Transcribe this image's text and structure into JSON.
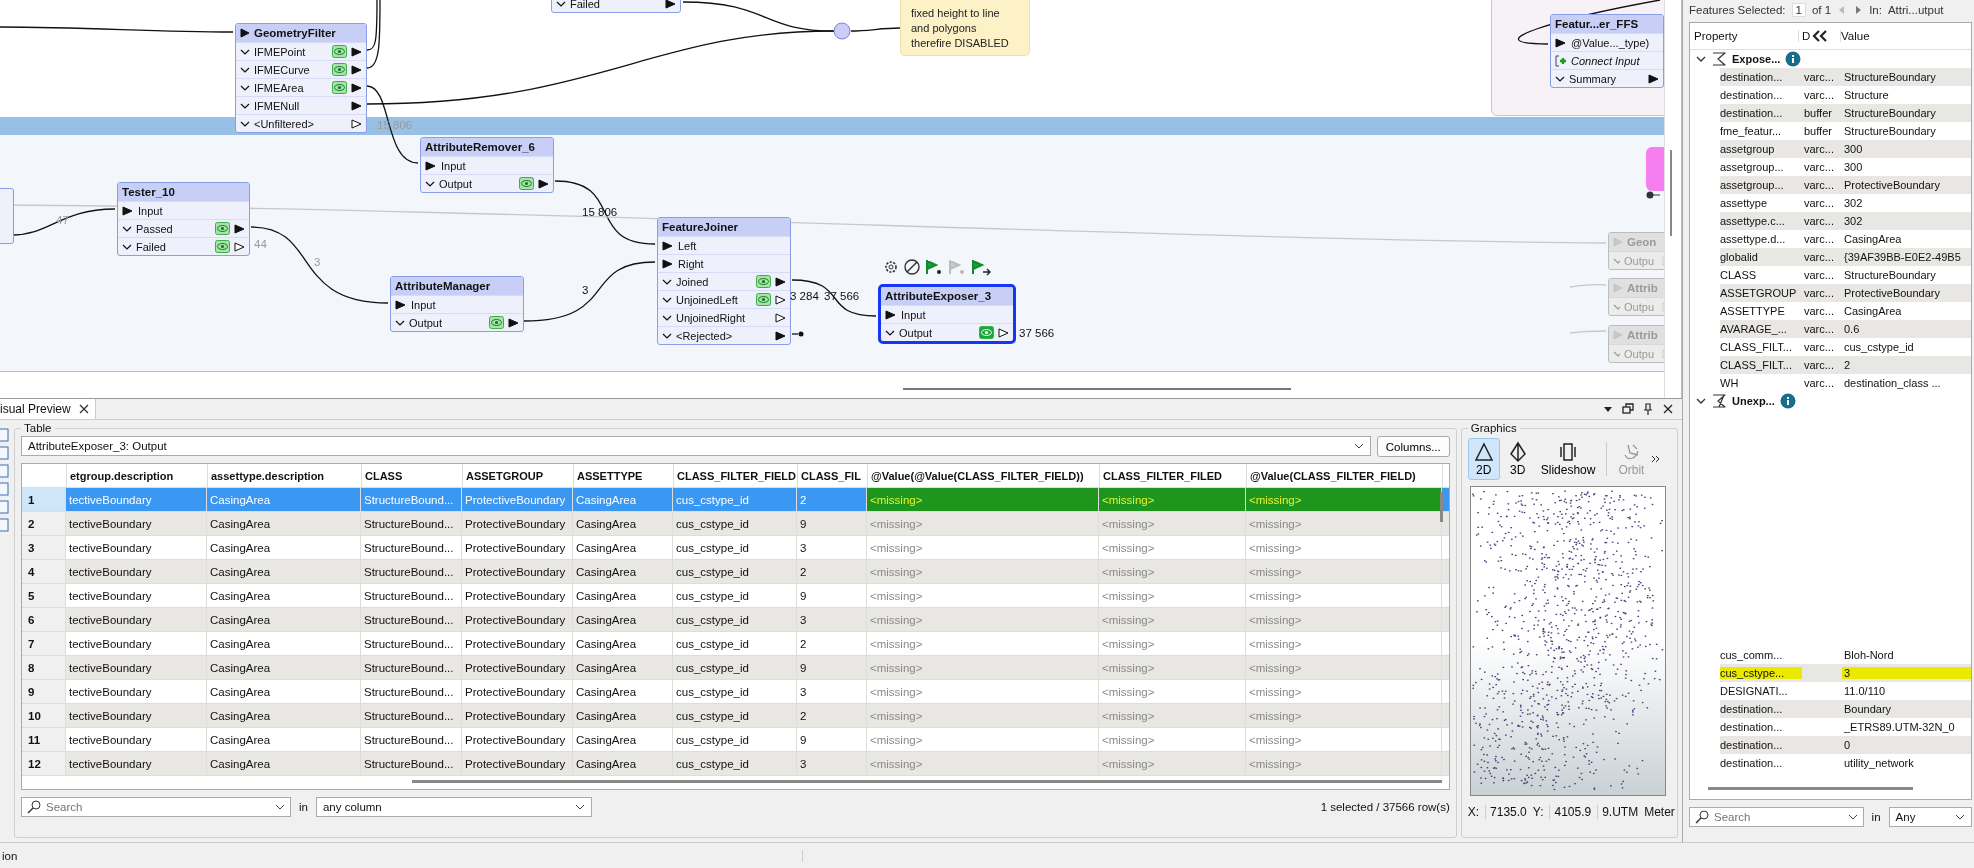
{
  "canvas": {
    "nodes": [
      {
        "selected": false,
        "disabled": false,
        "ports": [
          {
            "label": "Failed",
            "kind": "output",
            "cached": false,
            "connected": true
          }
        ]
      },
      {
        "title": "GeometryFilter",
        "selected": false,
        "disabled": false,
        "header_input": true,
        "ports": [
          {
            "label": "IFMEPoint",
            "kind": "output",
            "cached": true,
            "connected": true
          },
          {
            "label": "IFMECurve",
            "kind": "output",
            "cached": true,
            "connected": true
          },
          {
            "label": "IFMEArea",
            "kind": "output",
            "cached": true,
            "connected": true
          },
          {
            "label": "IFMENull",
            "kind": "output",
            "cached": false,
            "connected": true
          },
          {
            "label": "<Unfiltered>",
            "kind": "output",
            "cached": false,
            "connected": false
          }
        ]
      },
      {
        "title": "AttributeRemover_6",
        "selected": false,
        "disabled": false,
        "header_input": false,
        "ports": [
          {
            "label": "Input",
            "kind": "input",
            "connected": true
          },
          {
            "label": "Output",
            "kind": "output",
            "cached": true,
            "connected": true
          }
        ]
      },
      {
        "title": "Tester_10",
        "selected": false,
        "disabled": false,
        "header_input": false,
        "ports": [
          {
            "label": "Input",
            "kind": "input",
            "connected": true
          },
          {
            "label": "Passed",
            "kind": "output",
            "cached": true,
            "connected": true
          },
          {
            "label": "Failed",
            "kind": "output",
            "cached": true,
            "connected": false
          }
        ]
      },
      {
        "title": "FeatureJoiner",
        "selected": false,
        "disabled": false,
        "header_input": false,
        "ports": [
          {
            "label": "Left",
            "kind": "input",
            "connected": true
          },
          {
            "label": "Right",
            "kind": "input",
            "connected": true
          },
          {
            "label": "Joined",
            "kind": "output",
            "cached": true,
            "connected": true
          },
          {
            "label": "UnjoinedLeft",
            "kind": "output",
            "cached": true,
            "connected": false
          },
          {
            "label": "UnjoinedRight",
            "kind": "output",
            "cached": false,
            "connected": false
          },
          {
            "label": "<Rejected>",
            "kind": "output",
            "cached": false,
            "connected": true
          }
        ]
      },
      {
        "title": "AttributeManager",
        "selected": false,
        "disabled": false,
        "header_input": false,
        "ports": [
          {
            "label": "Input",
            "kind": "input",
            "connected": true
          },
          {
            "label": "Output",
            "kind": "output",
            "cached": true,
            "connected": true
          }
        ]
      },
      {
        "title": "AttributeExposer_3",
        "selected": true,
        "disabled": false,
        "header_input": false,
        "ports": [
          {
            "label": "Input",
            "kind": "input",
            "connected": true
          },
          {
            "label": "Output",
            "kind": "output",
            "cached": true,
            "connected": false
          }
        ]
      },
      {
        "title": "Featur...er_FFS",
        "selected": false,
        "disabled": false,
        "header_input": false,
        "ports": [
          {
            "label": "@Value..._type)",
            "kind": "input",
            "connected": true
          },
          {
            "label": "Connect Input",
            "kind": "add"
          },
          {
            "label": "Summary",
            "kind": "output",
            "cached": false,
            "connected": true
          }
        ]
      },
      {
        "title": "Geon",
        "selected": false,
        "disabled": true,
        "header_input": true,
        "ports": [
          {
            "label": "Outpu",
            "kind": "output",
            "cached": false,
            "connected": false
          }
        ]
      },
      {
        "title": "Attrib",
        "selected": false,
        "disabled": true,
        "header_input": true,
        "ports": [
          {
            "label": "Outpu",
            "kind": "output",
            "cached": false,
            "connected": false
          }
        ]
      },
      {
        "title": "Attrib",
        "selected": false,
        "disabled": true,
        "header_input": true,
        "ports": [
          {
            "label": "Outpu",
            "kind": "output",
            "cached": false,
            "connected": false
          }
        ]
      }
    ],
    "note": {
      "lines": [
        "fixed height to line",
        "and polygons",
        "therefire DISABLED"
      ]
    },
    "counts": [
      {
        "text": "15 806",
        "dim": true
      },
      {
        "text": "47",
        "dim": true
      },
      {
        "text": "44",
        "dim": true
      },
      {
        "text": "3",
        "dim": true
      },
      {
        "text": "15 806",
        "dim": false
      },
      {
        "text": "3",
        "dim": false
      },
      {
        "text": "3 284",
        "dim": false
      },
      {
        "text": "37 566",
        "dim": false
      },
      {
        "text": "37 566",
        "dim": false
      }
    ]
  },
  "preview": {
    "tab": "isual Preview",
    "table": {
      "title": "Table",
      "source": "AttributeExposer_3: Output",
      "columns_button": "Columns...",
      "columns": [
        {
          "label": "etgroup.description",
          "missing": false
        },
        {
          "label": "assettype.description",
          "missing": false
        },
        {
          "label": "CLASS",
          "missing": false
        },
        {
          "label": "ASSETGROUP",
          "missing": false
        },
        {
          "label": "ASSETTYPE",
          "missing": false
        },
        {
          "label": "CLASS_FILTER_FIELD",
          "missing": false
        },
        {
          "label": "CLASS_FIL",
          "missing": false
        },
        {
          "label": "@Value(@Value(CLASS_FILTER_FIELD))",
          "missing": true
        },
        {
          "label": "CLASS_FILTER_FILED",
          "missing": true
        },
        {
          "label": "@Value(CLASS_FILTER_FIELD)",
          "missing": true
        }
      ],
      "rows": [
        {
          "number": "1",
          "selected": true,
          "highlighted": true,
          "cells": [
            "tectiveBoundary",
            "CasingArea",
            "StructureBound...",
            "ProtectiveBoundary",
            "CasingArea",
            "cus_cstype_id",
            "2",
            "<missing>",
            "<missing>",
            "<missing>"
          ]
        },
        {
          "number": "2",
          "selected": false,
          "highlighted": false,
          "cells": [
            "tectiveBoundary",
            "CasingArea",
            "StructureBound...",
            "ProtectiveBoundary",
            "CasingArea",
            "cus_cstype_id",
            "9",
            "<missing>",
            "<missing>",
            "<missing>"
          ]
        },
        {
          "number": "3",
          "selected": false,
          "highlighted": false,
          "cells": [
            "tectiveBoundary",
            "CasingArea",
            "StructureBound...",
            "ProtectiveBoundary",
            "CasingArea",
            "cus_cstype_id",
            "3",
            "<missing>",
            "<missing>",
            "<missing>"
          ]
        },
        {
          "number": "4",
          "selected": false,
          "highlighted": false,
          "cells": [
            "tectiveBoundary",
            "CasingArea",
            "StructureBound...",
            "ProtectiveBoundary",
            "CasingArea",
            "cus_cstype_id",
            "2",
            "<missing>",
            "<missing>",
            "<missing>"
          ]
        },
        {
          "number": "5",
          "selected": false,
          "highlighted": false,
          "cells": [
            "tectiveBoundary",
            "CasingArea",
            "StructureBound...",
            "ProtectiveBoundary",
            "CasingArea",
            "cus_cstype_id",
            "9",
            "<missing>",
            "<missing>",
            "<missing>"
          ]
        },
        {
          "number": "6",
          "selected": false,
          "highlighted": false,
          "cells": [
            "tectiveBoundary",
            "CasingArea",
            "StructureBound...",
            "ProtectiveBoundary",
            "CasingArea",
            "cus_cstype_id",
            "3",
            "<missing>",
            "<missing>",
            "<missing>"
          ]
        },
        {
          "number": "7",
          "selected": false,
          "highlighted": false,
          "cells": [
            "tectiveBoundary",
            "CasingArea",
            "StructureBound...",
            "ProtectiveBoundary",
            "CasingArea",
            "cus_cstype_id",
            "2",
            "<missing>",
            "<missing>",
            "<missing>"
          ]
        },
        {
          "number": "8",
          "selected": false,
          "highlighted": false,
          "cells": [
            "tectiveBoundary",
            "CasingArea",
            "StructureBound...",
            "ProtectiveBoundary",
            "CasingArea",
            "cus_cstype_id",
            "9",
            "<missing>",
            "<missing>",
            "<missing>"
          ]
        },
        {
          "number": "9",
          "selected": false,
          "highlighted": false,
          "cells": [
            "tectiveBoundary",
            "CasingArea",
            "StructureBound...",
            "ProtectiveBoundary",
            "CasingArea",
            "cus_cstype_id",
            "3",
            "<missing>",
            "<missing>",
            "<missing>"
          ]
        },
        {
          "number": "10",
          "selected": false,
          "highlighted": false,
          "cells": [
            "tectiveBoundary",
            "CasingArea",
            "StructureBound...",
            "ProtectiveBoundary",
            "CasingArea",
            "cus_cstype_id",
            "2",
            "<missing>",
            "<missing>",
            "<missing>"
          ]
        },
        {
          "number": "11",
          "selected": false,
          "highlighted": false,
          "cells": [
            "tectiveBoundary",
            "CasingArea",
            "StructureBound...",
            "ProtectiveBoundary",
            "CasingArea",
            "cus_cstype_id",
            "9",
            "<missing>",
            "<missing>",
            "<missing>"
          ]
        },
        {
          "number": "12",
          "selected": false,
          "highlighted": false,
          "cells": [
            "tectiveBoundary",
            "CasingArea",
            "StructureBound...",
            "ProtectiveBoundary",
            "CasingArea",
            "cus_cstype_id",
            "3",
            "<missing>",
            "<missing>",
            "<missing>"
          ]
        }
      ],
      "search": {
        "placeholder": "Search",
        "in": "in",
        "scope": "any column"
      },
      "summary": "1 selected / 37566 row(s)"
    },
    "graphics": {
      "title": "Graphics",
      "tools": [
        {
          "label": "2D",
          "kind": "flat",
          "selected": true,
          "disabled": false
        },
        {
          "label": "3D",
          "kind": "solid",
          "selected": false,
          "disabled": false
        },
        {
          "label": "Slideshow",
          "kind": "slideshow",
          "selected": false,
          "disabled": false
        },
        {
          "label": "Orbit",
          "kind": "orbit",
          "selected": false,
          "disabled": true
        }
      ],
      "coords": [
        {
          "label": "X:",
          "value": "7135.0"
        },
        {
          "label": "Y:",
          "value": "4105.9"
        }
      ],
      "crs": "9.UTM",
      "units": "Meter"
    }
  },
  "inspector": {
    "label": "Features Selected:",
    "current": "1",
    "total": "of 1",
    "in_label": "In:",
    "in_value": "Attri...utput",
    "columns": [
      "Property",
      "D",
      "Value"
    ],
    "groups": [
      {
        "label": "Expose...",
        "kind": "exposed",
        "expanded": true,
        "rows": [
          {
            "name": "destination...",
            "type": "varc...",
            "value": "StructureBoundary",
            "highlighted": false
          },
          {
            "name": "destination...",
            "type": "varc...",
            "value": "Structure",
            "highlighted": false
          },
          {
            "name": "destination...",
            "type": "buffer",
            "value": "StructureBoundary",
            "highlighted": false
          },
          {
            "name": "fme_featur...",
            "type": "buffer",
            "value": "StructureBoundary",
            "highlighted": false
          },
          {
            "name": "assetgroup",
            "type": "varc...",
            "value": "300",
            "highlighted": false
          },
          {
            "name": "assetgroup...",
            "type": "varc...",
            "value": "300",
            "highlighted": false
          },
          {
            "name": "assetgroup...",
            "type": "varc...",
            "value": "ProtectiveBoundary",
            "highlighted": false
          },
          {
            "name": "assettype",
            "type": "varc...",
            "value": "302",
            "highlighted": false
          },
          {
            "name": "assettype.c...",
            "type": "varc...",
            "value": "302",
            "highlighted": false
          },
          {
            "name": "assettype.d...",
            "type": "varc...",
            "value": "CasingArea",
            "highlighted": false
          },
          {
            "name": "globalid",
            "type": "varc...",
            "value": "{39AF39BB-E0E2-49B5",
            "highlighted": false
          },
          {
            "name": "CLASS",
            "type": "varc...",
            "value": "StructureBoundary",
            "highlighted": false
          },
          {
            "name": "ASSETGROUP",
            "type": "varc...",
            "value": "ProtectiveBoundary",
            "highlighted": false
          },
          {
            "name": "ASSETTYPE",
            "type": "varc...",
            "value": "CasingArea",
            "highlighted": false
          },
          {
            "name": "AVARAGE_...",
            "type": "varc...",
            "value": " 0.6",
            "highlighted": false
          },
          {
            "name": "CLASS_FILT...",
            "type": "varc...",
            "value": "cus_cstype_id",
            "highlighted": false
          },
          {
            "name": "CLASS_FILT...",
            "type": "varc...",
            "value": "2",
            "highlighted": false
          },
          {
            "name": "WH",
            "type": "varc...",
            "value": "destination_class ...",
            "highlighted": false
          }
        ]
      },
      {
        "label": "Unexp...",
        "kind": "unexposed",
        "expanded": true,
        "rows": [
          {
            "name": "cus_comm...",
            "value": "Bloh-Nord",
            "highlighted": false
          },
          {
            "name": "cus_cstype...",
            "value": "3",
            "highlighted": true
          },
          {
            "name": "DESIGNATI...",
            "value": "11.0/110",
            "highlighted": false
          },
          {
            "name": "destination...",
            "value": "Boundary",
            "highlighted": false
          },
          {
            "name": "destination...",
            "value": "_ETRS89.UTM-32N_0",
            "highlighted": false
          },
          {
            "name": "destination...",
            "value": "0",
            "highlighted": false
          },
          {
            "name": "destination...",
            "value": "utility_network",
            "highlighted": false
          }
        ]
      }
    ],
    "search": {
      "placeholder": "Search",
      "in": "in",
      "scope": "Any"
    }
  },
  "status_bar": {
    "text": "ion"
  }
}
